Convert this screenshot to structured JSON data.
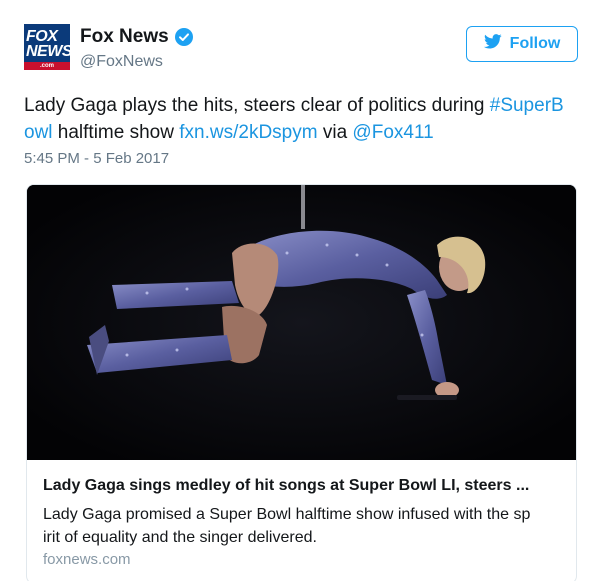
{
  "account": {
    "name": "Fox News",
    "handle": "@FoxNews",
    "avatar_text": {
      "line1": "FOX",
      "line2": "NEWS",
      "line3": ".com"
    }
  },
  "follow_button": {
    "label": "Follow",
    "icon": "twitter-bird-icon"
  },
  "tweet": {
    "text_part1": "Lady Gaga plays the hits, steers clear of politics during ",
    "hashtag": "#SuperBowl",
    "hashtag_display_line1": "#SuperB",
    "hashtag_display_line2": "owl",
    "text_part2": " halftime show ",
    "link": "fxn.ws/2kDspym",
    "text_part3": " via ",
    "mention": "@Fox411",
    "timestamp": "5:45 PM - 5 Feb 2017"
  },
  "card": {
    "title": "Lady Gaga sings medley of hit songs at Super Bowl LI, steers ...",
    "description_line1": "Lady Gaga promised a Super Bowl halftime show infused with the sp",
    "description_line2": "irit of equality and the singer delivered.",
    "domain": "foxnews.com"
  },
  "colors": {
    "accent": "#1da1f2",
    "link": "#1b95e0",
    "secondary_text": "#657786",
    "fox_blue": "#0b3a7a",
    "fox_red": "#c8102e"
  }
}
